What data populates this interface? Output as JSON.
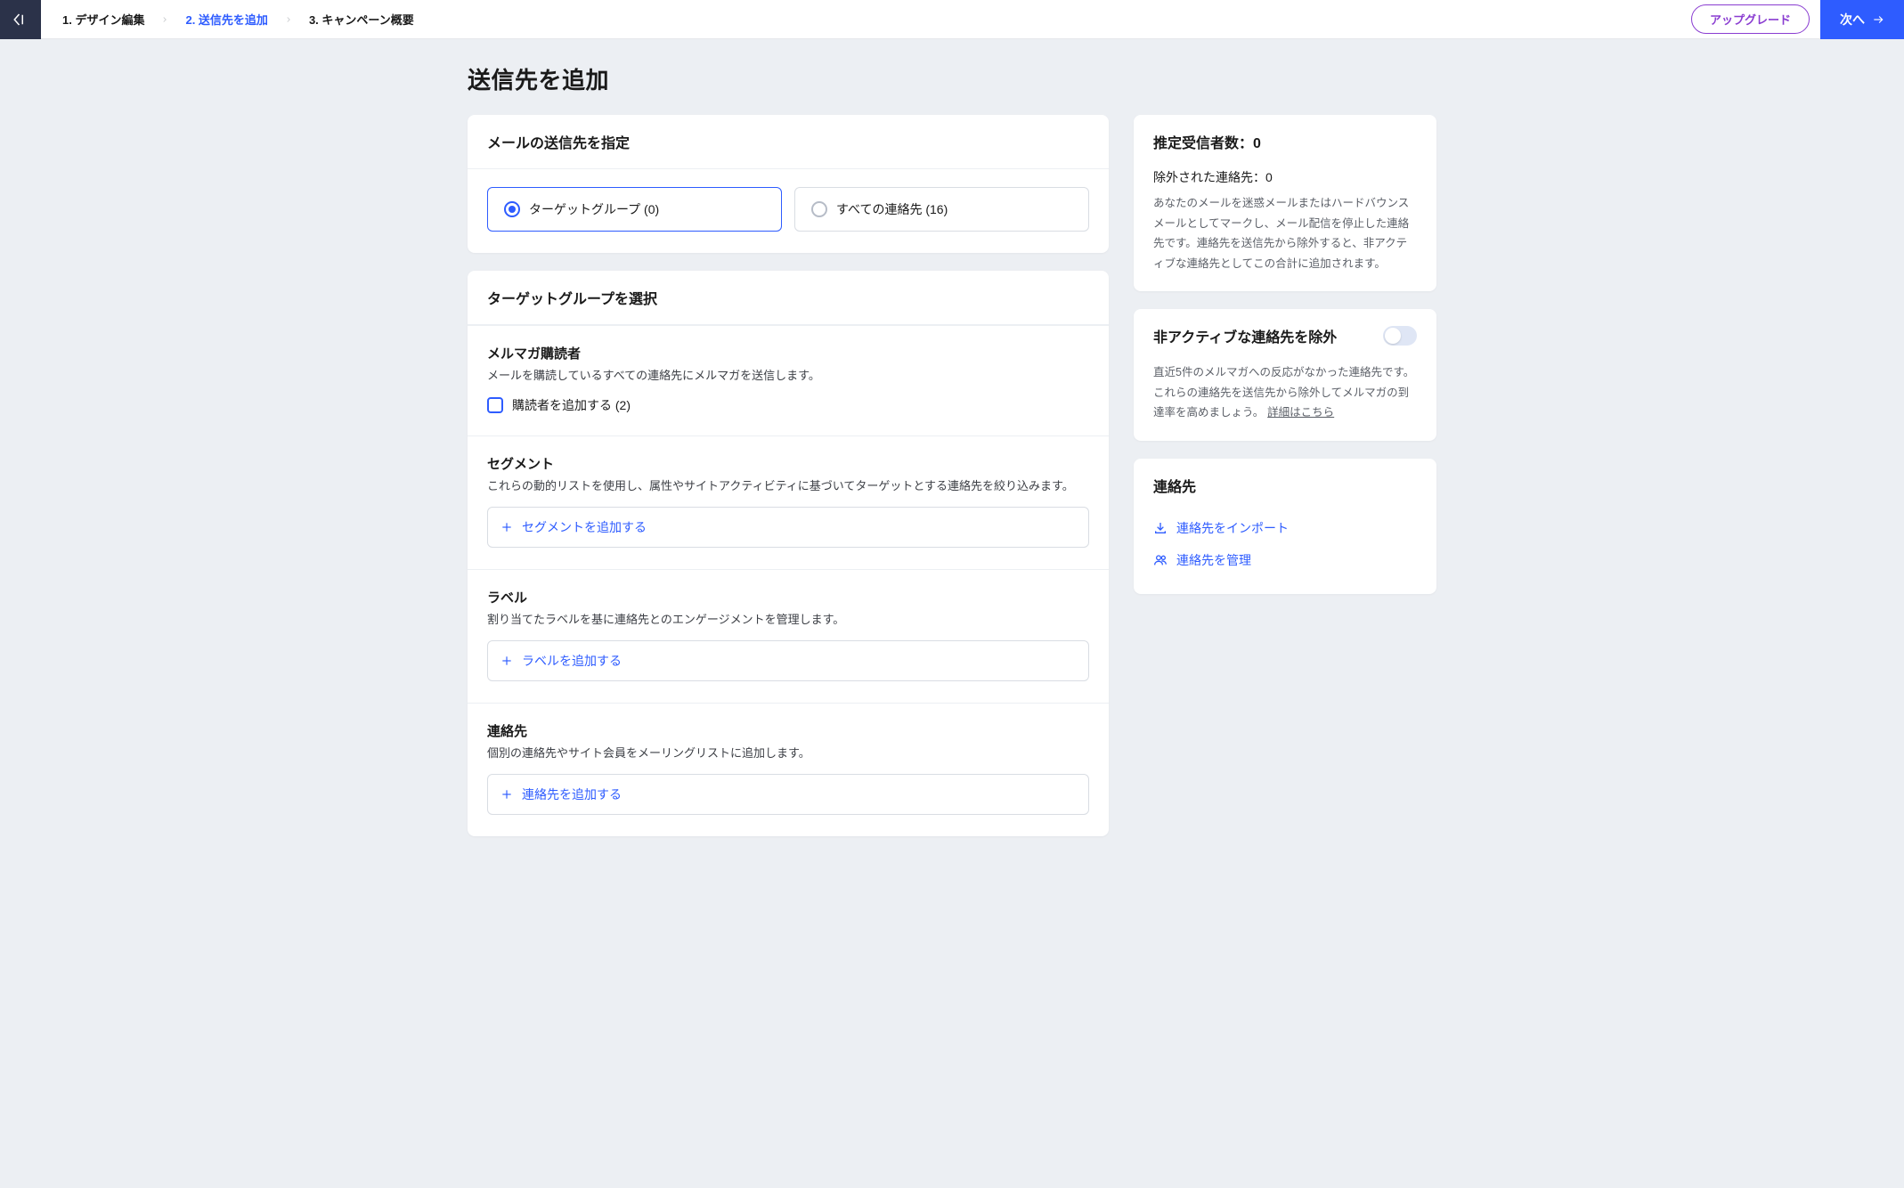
{
  "topbar": {
    "steps": {
      "step1": "1. デザイン編集",
      "step2": "2. 送信先を追加",
      "step3": "3. キャンペーン概要"
    },
    "upgrade": "アップグレード",
    "next": "次へ"
  },
  "page": {
    "title": "送信先を追加"
  },
  "specify": {
    "header": "メールの送信先を指定",
    "options": {
      "target": "ターゲットグループ (0)",
      "all": "すべての連絡先 (16)"
    }
  },
  "targetGroup": {
    "header": "ターゲットグループを選択",
    "subscribers": {
      "title": "メルマガ購読者",
      "desc": "メールを購読しているすべての連絡先にメルマガを送信します。",
      "checkboxLabel": "購読者を追加する (2)"
    },
    "segments": {
      "title": "セグメント",
      "desc": "これらの動的リストを使用し、属性やサイトアクティビティに基づいてターゲットとする連絡先を絞り込みます。",
      "button": "セグメントを追加する"
    },
    "labels": {
      "title": "ラベル",
      "desc": "割り当てたラベルを基に連絡先とのエンゲージメントを管理します。",
      "button": "ラベルを追加する"
    },
    "contacts": {
      "title": "連絡先",
      "desc": "個別の連絡先やサイト会員をメーリングリストに追加します。",
      "button": "連絡先を追加する"
    }
  },
  "side": {
    "estimated": {
      "header": "推定受信者数：0",
      "excludedLine": "除外された連絡先：0",
      "desc": "あなたのメールを迷惑メールまたはハードバウンスメールとしてマークし、メール配信を停止した連絡先です。連絡先を送信先から除外すると、非アクティブな連絡先としてこの合計に追加されます。"
    },
    "inactive": {
      "header": "非アクティブな連絡先を除外",
      "desc": "直近5件のメルマガへの反応がなかった連絡先です。これらの連絡先を送信先から除外してメルマガの到達率を高めましょう。",
      "link": "詳細はこちら"
    },
    "contacts": {
      "header": "連絡先",
      "import": "連絡先をインポート",
      "manage": "連絡先を管理"
    }
  }
}
